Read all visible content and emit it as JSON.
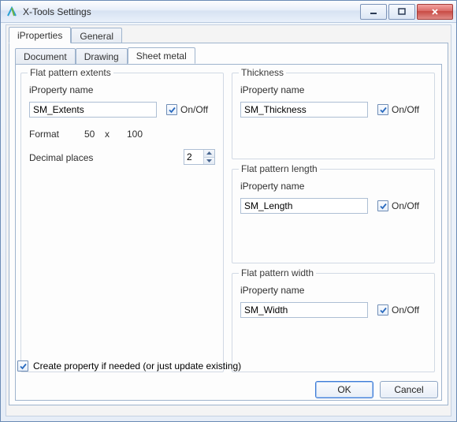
{
  "window": {
    "title": "X-Tools Settings"
  },
  "topTabs": {
    "t0": "iProperties",
    "t1": "General"
  },
  "subTabs": {
    "t0": "Document",
    "t1": "Drawing",
    "t2": "Sheet metal"
  },
  "groups": {
    "extents": {
      "legend": "Flat pattern extents",
      "propLabel": "iProperty name",
      "propValue": "SM_Extents",
      "onoff": "On/Off",
      "formatLabel": "Format",
      "formatA": "50",
      "formatX": "x",
      "formatB": "100",
      "decLabel": "Decimal places",
      "decValue": "2"
    },
    "thickness": {
      "legend": "Thickness",
      "propLabel": "iProperty name",
      "propValue": "SM_Thickness",
      "onoff": "On/Off"
    },
    "length": {
      "legend": "Flat pattern length",
      "propLabel": "iProperty name",
      "propValue": "SM_Length",
      "onoff": "On/Off"
    },
    "width": {
      "legend": "Flat pattern width",
      "propLabel": "iProperty name",
      "propValue": "SM_Width",
      "onoff": "On/Off"
    }
  },
  "bottom": {
    "createLabel": "Create property if needed (or just update existing)",
    "ok": "OK",
    "cancel": "Cancel"
  }
}
